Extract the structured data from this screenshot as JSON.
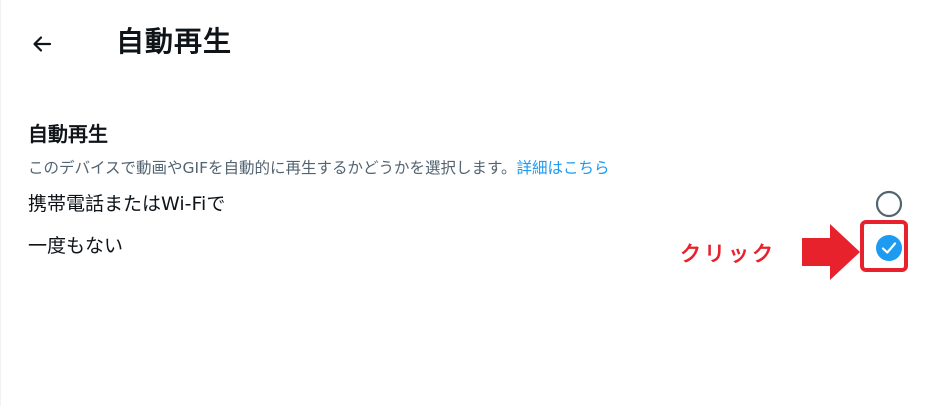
{
  "header": {
    "back_icon": "arrow-left-icon",
    "title": "自動再生"
  },
  "section": {
    "title": "自動再生",
    "description": "このデバイスで動画やGIFを自動的に再生するかどうかを選択します。",
    "learn_more_link": "詳細はこちら"
  },
  "options": [
    {
      "label": "携帯電話またはWi-Fiで",
      "selected": false
    },
    {
      "label": "一度もない",
      "selected": true
    }
  ],
  "annotation": {
    "text": "クリック",
    "color": "#e8222d"
  },
  "colors": {
    "accent": "#1d9bf0",
    "text": "#0f1419",
    "secondary_text": "#536471"
  }
}
